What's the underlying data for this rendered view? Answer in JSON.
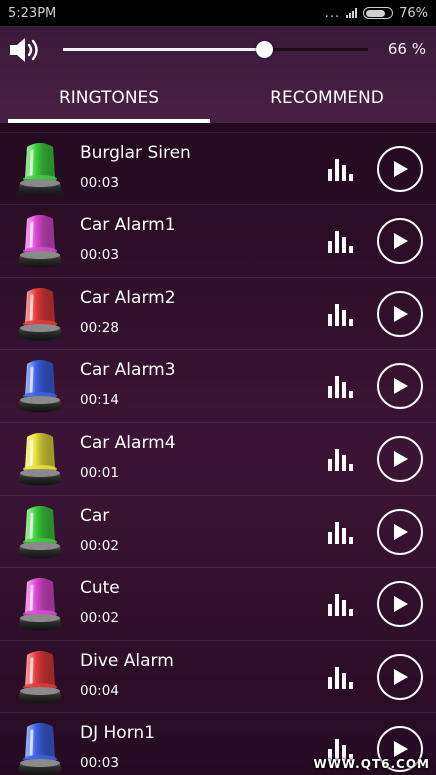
{
  "status_bar": {
    "time": "5:23PM",
    "dots": "...",
    "battery_pct": "76%",
    "battery_level": 0.76
  },
  "volume": {
    "level": 0.66,
    "label": "66 %"
  },
  "tabs": [
    {
      "label": "RINGTONES",
      "active": true
    },
    {
      "label": "RECOMMEND",
      "active": false
    }
  ],
  "ringtones": [
    {
      "name": "",
      "duration": "00:03",
      "color": "#e8e8e8"
    },
    {
      "name": "Burglar Siren",
      "duration": "00:03",
      "color": "#3fd23f"
    },
    {
      "name": "Car Alarm1",
      "duration": "00:03",
      "color": "#e04bd8"
    },
    {
      "name": "Car Alarm2",
      "duration": "00:28",
      "color": "#e83b3b"
    },
    {
      "name": "Car Alarm3",
      "duration": "00:14",
      "color": "#3f63e8"
    },
    {
      "name": "Car Alarm4",
      "duration": "00:01",
      "color": "#e8e23a"
    },
    {
      "name": "Car",
      "duration": "00:02",
      "color": "#3fd23f"
    },
    {
      "name": "Cute",
      "duration": "00:02",
      "color": "#e04bd8"
    },
    {
      "name": "Dive Alarm",
      "duration": "00:04",
      "color": "#e83b3b"
    },
    {
      "name": "DJ Horn1",
      "duration": "00:03",
      "color": "#3f63e8"
    }
  ],
  "watermark": "WWW.QT6.COM"
}
